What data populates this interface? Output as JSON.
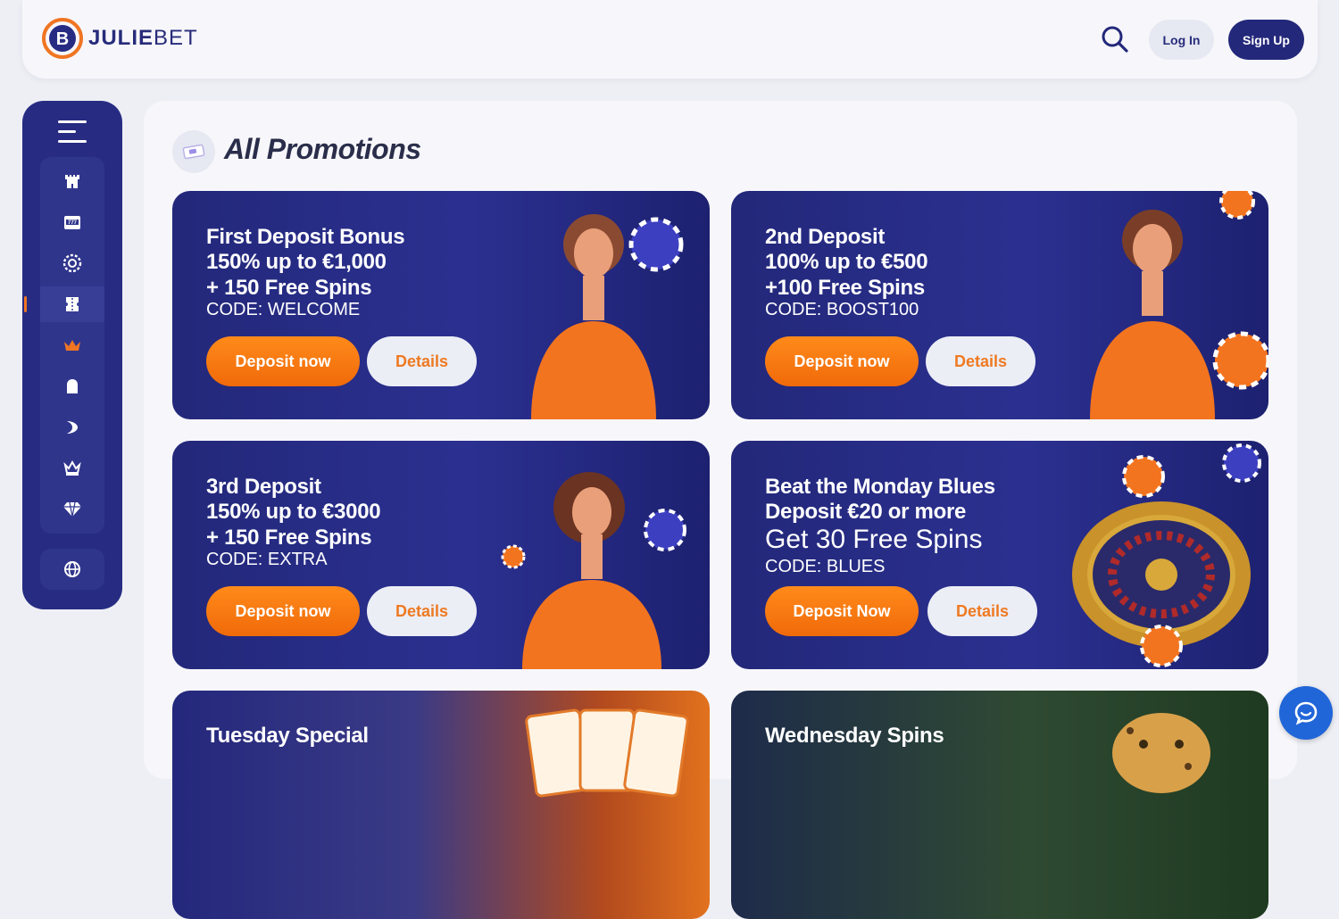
{
  "brand": {
    "name_bold": "JULIE",
    "name_thin": "BET",
    "colors": {
      "primary": "#272c82",
      "accent": "#f07522"
    }
  },
  "header": {
    "login_label": "Log In",
    "signup_label": "Sign Up"
  },
  "sidebar": {
    "items": [
      {
        "icon": "castle-icon"
      },
      {
        "icon": "slot-machine-icon"
      },
      {
        "icon": "roulette-icon"
      },
      {
        "icon": "ticket-icon",
        "active": true
      },
      {
        "icon": "crown-icon"
      },
      {
        "icon": "bag-icon"
      },
      {
        "icon": "play-icon"
      },
      {
        "icon": "vip-crown-icon"
      },
      {
        "icon": "diamond-icon"
      }
    ],
    "language_icon": "globe-icon"
  },
  "page": {
    "title": "All Promotions"
  },
  "promotions": [
    {
      "line1": "First Deposit Bonus",
      "line2": "150% up to €1,000",
      "line3": "+ 150 Free Spins",
      "code": "CODE: WELCOME",
      "deposit_label": "Deposit now",
      "details_label": "Details"
    },
    {
      "line1": "2nd Deposit",
      "line2": "100% up to €500",
      "line3": "+100 Free Spins",
      "code": "CODE: BOOST100",
      "deposit_label": "Deposit now",
      "details_label": "Details"
    },
    {
      "line1": "3rd Deposit",
      "line2": "150% up to €3000",
      "line3": "+ 150 Free Spins",
      "code": "CODE: EXTRA",
      "deposit_label": "Deposit now",
      "details_label": "Details"
    },
    {
      "line1": "Beat the Monday Blues",
      "line2": "Deposit €20 or more",
      "line3": "Get 30 Free Spins",
      "code": "CODE: BLUES",
      "deposit_label": "Deposit Now",
      "details_label": "Details"
    },
    {
      "line1": "Tuesday Special"
    },
    {
      "line1": "Wednesday Spins"
    }
  ]
}
